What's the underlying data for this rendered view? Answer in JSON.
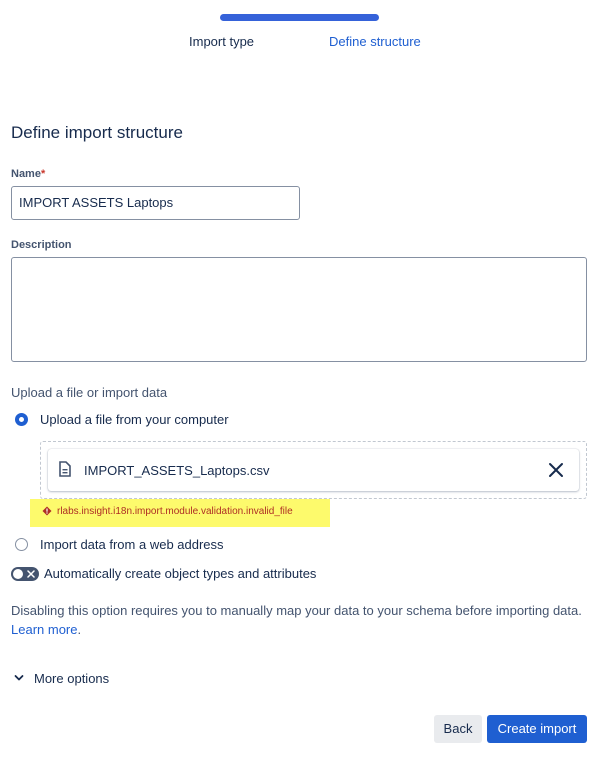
{
  "wizard": {
    "steps": [
      {
        "label": "Import type"
      },
      {
        "label": "Define structure"
      }
    ]
  },
  "form": {
    "title": "Define import structure",
    "name_label": "Name",
    "required_marker": "*",
    "name_value": "IMPORT ASSETS Laptops",
    "description_label": "Description",
    "description_value": "",
    "upload_section_label": "Upload a file or import data",
    "option_upload": "Upload a file from your computer",
    "option_upload_selected": true,
    "file": {
      "name": "IMPORT_ASSETS_Laptops.csv",
      "icon": "file-icon"
    },
    "error_message": "rlabs.insight.i18n.import.module.validation.invalid_file",
    "error_highlight_color": "#fdfa6c",
    "option_web": "Import data from a web address",
    "toggle_label": "Automatically create object types and attributes",
    "toggle_on": false,
    "help_text": "Disabling this option requires you to manually map your data to your schema before importing data.",
    "help_link": "Learn more",
    "help_suffix": ".",
    "more_options": "More options"
  },
  "buttons": {
    "back": "Back",
    "create": "Create import"
  },
  "colors": {
    "primary": "#1f5fd1",
    "progress": "#3562d9",
    "error": "#ae2e24"
  }
}
